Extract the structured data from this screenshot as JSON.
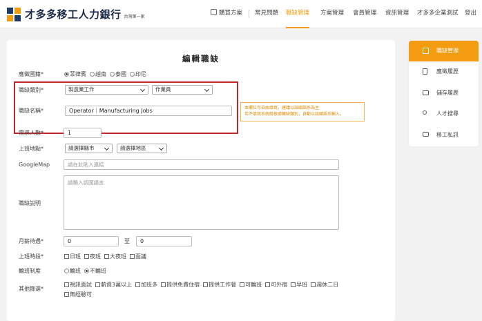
{
  "header": {
    "brand": "才多多移工人力銀行",
    "brand_sub": "台灣第一家",
    "nav": [
      {
        "label": "購買方案",
        "icon": "cart-icon"
      },
      {
        "label": "常見問題"
      },
      {
        "label": "職缺管理",
        "active": true
      },
      {
        "label": "方案管理"
      },
      {
        "label": "會員管理"
      },
      {
        "label": "資訊管理"
      },
      {
        "label": "才多多企業測試"
      },
      {
        "label": "登出"
      }
    ]
  },
  "form": {
    "title": "編輯職缺",
    "nationality": {
      "label": "應徵國籍*",
      "options": [
        "菲律賓",
        "越南",
        "泰國",
        "印尼"
      ],
      "selected": "菲律賓"
    },
    "category": {
      "label": "職缺類別*",
      "value1": "製造業工作",
      "value2": "作業員"
    },
    "job_name": {
      "label": "職缺名稱*",
      "value": "Operator｜Manufacturing Jobs",
      "note_line1": "本欄位可自由填寫，建議以該國語系為主",
      "note_line2": "若不填寫系統將根據職缺類別，自動以該國語系輸入。"
    },
    "headcount": {
      "label": "需求人數*",
      "value": "1"
    },
    "location": {
      "label": "上班地點*",
      "city": "請選擇縣市",
      "district": "請選擇地區"
    },
    "googlemap": {
      "label": "GoogleMap",
      "placeholder": "請在此貼入連結"
    },
    "description": {
      "label": "職缺說明",
      "placeholder": "請輸入該國語言"
    },
    "salary": {
      "label": "月薪待遇*",
      "min": "0",
      "sep": "至",
      "max": "0"
    },
    "shift_time": {
      "label": "上班時段*",
      "options": [
        "日班",
        "夜班",
        "大夜班",
        "面議"
      ]
    },
    "rotation": {
      "label": "輪班制度",
      "options": [
        "輪班",
        "不輪班"
      ],
      "selected": "不輪班"
    },
    "benefits": {
      "label": "其他篩選*",
      "options_row1": [
        "視訊面試",
        "薪資3萬以上",
        "加班多",
        "提供免費住宿",
        "提供工作餐",
        "可輪班",
        "可外宿",
        "早班",
        "週休二日"
      ],
      "options_row2": [
        "無經驗可"
      ]
    }
  },
  "sidebar": {
    "items": [
      {
        "label": "職缺管理",
        "icon": "briefcase-icon",
        "active": true
      },
      {
        "label": "應徵履歷",
        "icon": "document-icon"
      },
      {
        "label": "儲存履歷",
        "icon": "folder-icon"
      },
      {
        "label": "人才搜尋",
        "icon": "user-search-icon"
      },
      {
        "label": "移工私訊",
        "icon": "chat-icon"
      }
    ]
  },
  "colors": {
    "accent": "#f39c12",
    "highlight": "#c0272d",
    "brand_dark": "#1b2a48"
  }
}
